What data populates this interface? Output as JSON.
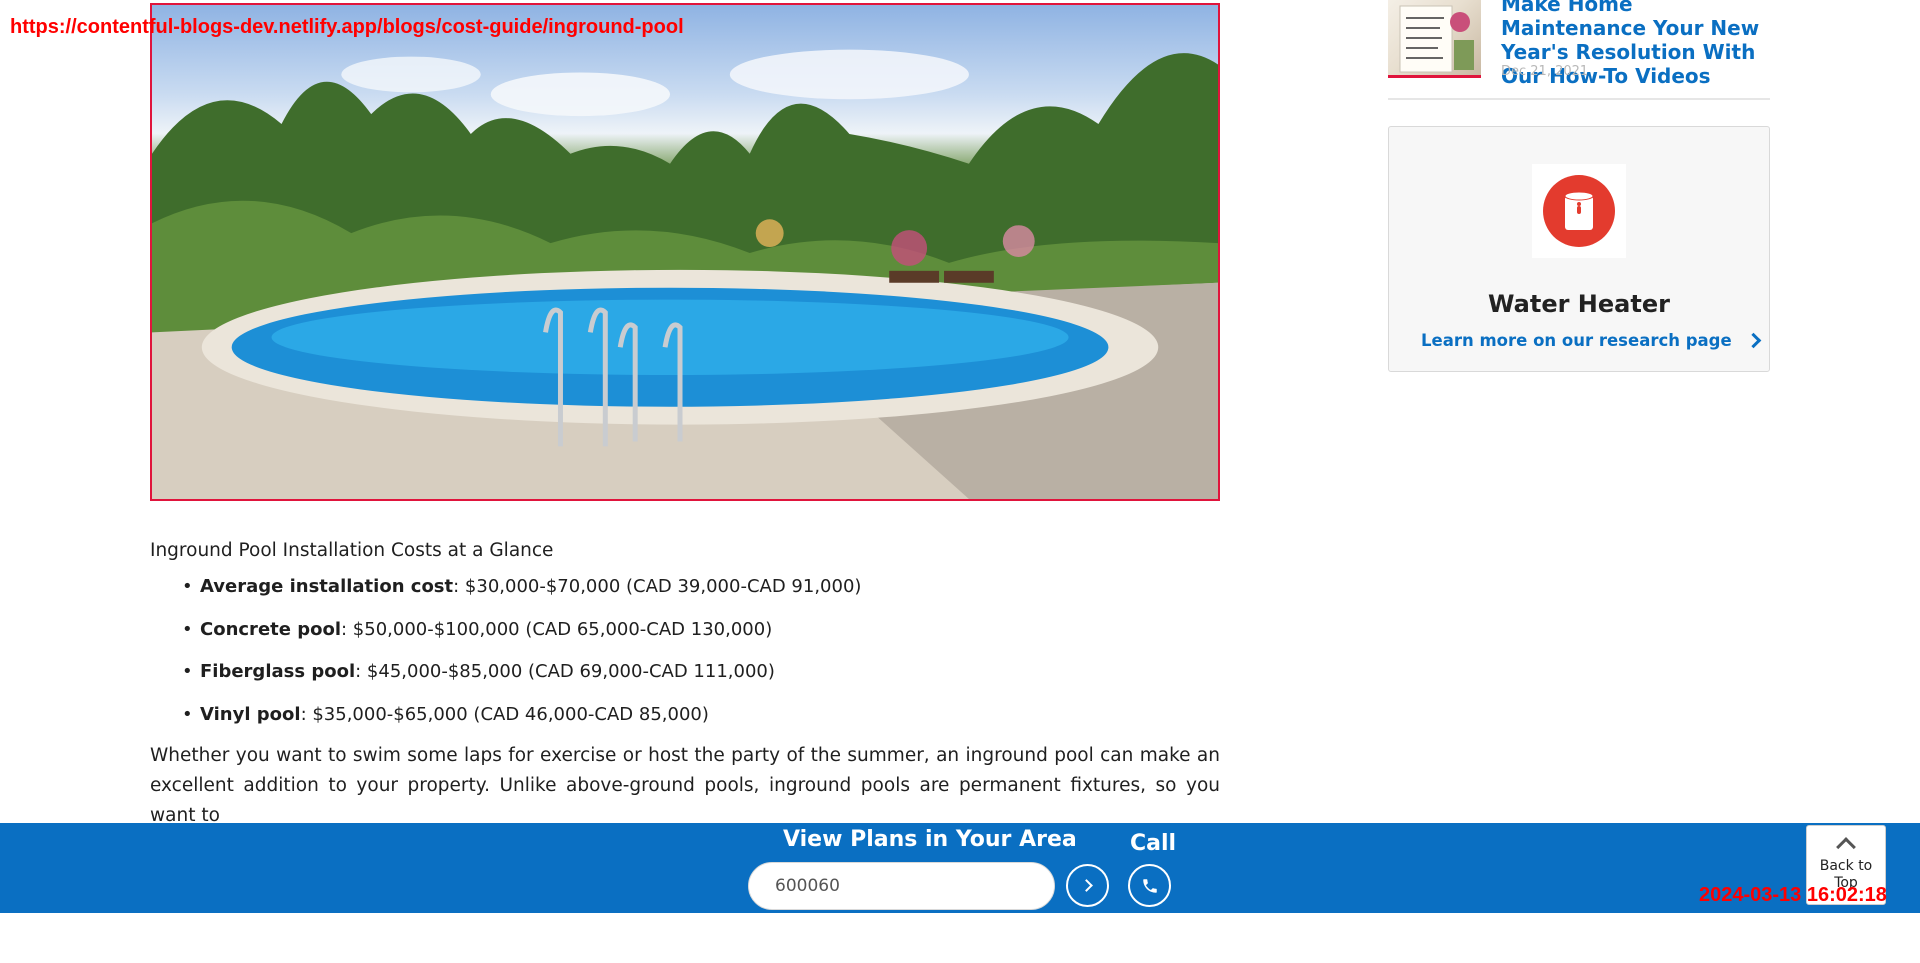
{
  "overlay": {
    "url": "https://contentful-blogs-dev.netlify.app/blogs/cost-guide/inground-pool",
    "timestamp": "2024-03-13 16:02:18"
  },
  "hero": {
    "image_alt": "Inground pool"
  },
  "article": {
    "heading": "Inground Pool Installation Costs at a Glance",
    "costs": [
      {
        "label": "Average installation cost",
        "value": ": $30,000-$70,000 (CAD 39,000-CAD 91,000)"
      },
      {
        "label": "Concrete pool",
        "value": ": $50,000-$100,000 (CAD 65,000-CAD 130,000)"
      },
      {
        "label": "Fiberglass pool",
        "value": ": $45,000-$85,000 (CAD 69,000-CAD 111,000)"
      },
      {
        "label": "Vinyl pool",
        "value": ": $35,000-$65,000 (CAD 46,000-CAD 85,000)"
      }
    ],
    "paragraph": "Whether you want to swim some laps for exercise or host the party of the summer, an inground pool can make an excellent addition to your property. Unlike above-ground pools, inground pools are permanent fixtures, so you want to"
  },
  "sidebar": {
    "recent_post": {
      "title": "Make Home Maintenance Your New Year's Resolution With Our How-To Videos",
      "date": "Dec 21, 2021"
    },
    "research_card": {
      "icon": "water-heater-icon",
      "title": "Water Heater",
      "link_label": "Learn more on our research page"
    }
  },
  "bottom_bar": {
    "title": "View Plans in Your Area",
    "zip_value": "600060",
    "call_label": "Call",
    "colors": {
      "bar": "#0a6fc2"
    }
  },
  "back_to_top": {
    "label": "Back to Top"
  }
}
